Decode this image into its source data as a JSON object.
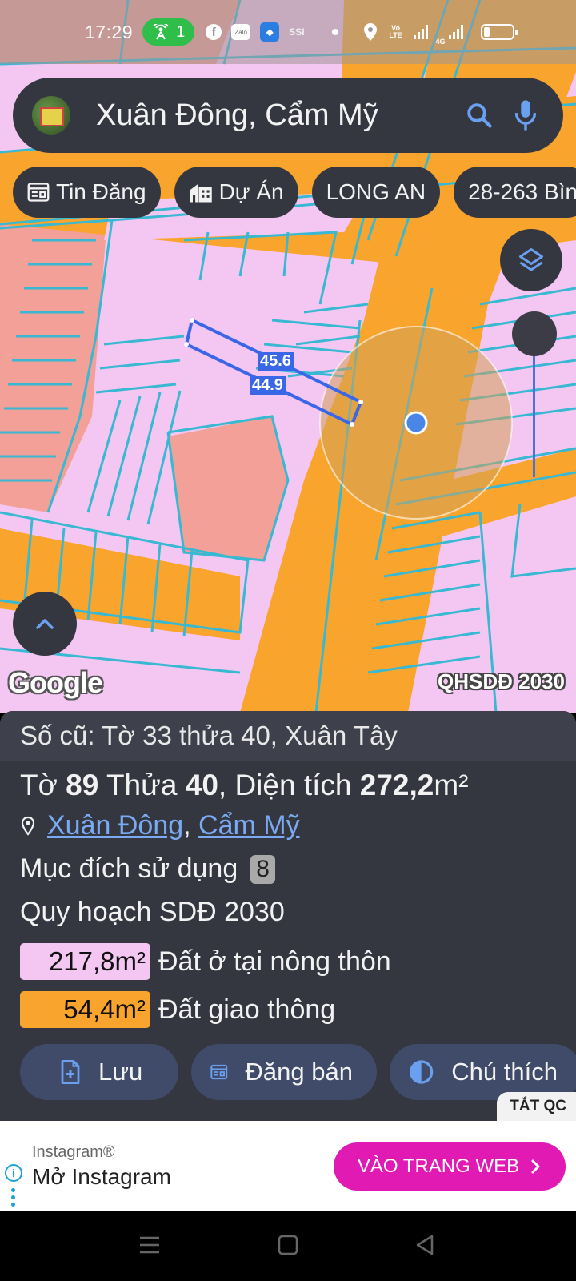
{
  "status_bar": {
    "time": "17:29",
    "hotspot_count": "1",
    "notification_icons": [
      "facebook-icon",
      "zalo-icon",
      "app-icon",
      "ssi-icon"
    ],
    "zalo_label": "Zalo",
    "ssi_label": "SSI",
    "volte_label": "Vo LTE",
    "network_label": "4G"
  },
  "search": {
    "query": "Xuân Đông, Cẩm Mỹ"
  },
  "chips": [
    {
      "label": "Tin Đăng",
      "icon": "listing-icon"
    },
    {
      "label": "Dự Án",
      "icon": "building-icon"
    },
    {
      "label": "LONG AN"
    },
    {
      "label": "28-263 Bìn"
    }
  ],
  "map": {
    "measure_top": "45.6",
    "measure_bottom": "44.9",
    "logo": "Google",
    "plan_label": "QHSDĐ 2030",
    "colors": {
      "residential": "#f4c6f2",
      "road": "#f9a42c",
      "existing": "#f2a098",
      "parcel_line": "#39b8d2",
      "selection": "#3a66e8"
    }
  },
  "info": {
    "old_ref": "Số cũ: Tờ 33 thửa 40, Xuân Tây",
    "sheet_label": "Tờ",
    "sheet_no": "89",
    "plot_label": "Thửa",
    "plot_no": "40",
    "area_label": ", Diện tích",
    "area_value": "272,2",
    "area_unit": "m²",
    "location_1": "Xuân Đông",
    "location_sep": ",",
    "location_2": "Cẩm Mỹ",
    "purpose_label": "Mục đích sử dụng",
    "purpose_count": "8",
    "plan_label": "Quy hoạch SDĐ 2030",
    "areas": [
      {
        "value": "217,8m²",
        "label": "Đất ở tại nông thôn",
        "color": "#f4c6f2"
      },
      {
        "value": "54,4m²",
        "label": "Đất giao thông",
        "color": "#f9a42c"
      }
    ]
  },
  "actions": {
    "save": "Lưu",
    "sell": "Đăng bán",
    "legend": "Chú thích"
  },
  "ad": {
    "off_label": "TẮT QC",
    "brand": "Instagram®",
    "title": "Mở Instagram",
    "cta": "VÀO TRANG WEB",
    "cta_color": "#e01ab2"
  }
}
